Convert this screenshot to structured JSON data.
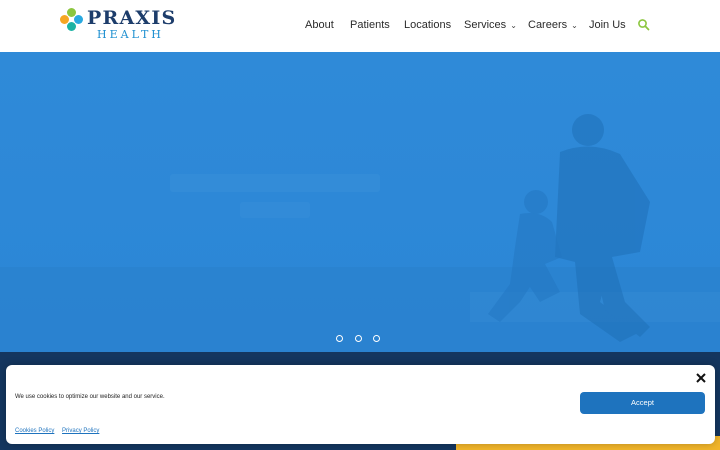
{
  "header": {
    "logo": {
      "name": "PRAXIS",
      "sub": "HEALTH"
    },
    "nav": [
      {
        "label": "About"
      },
      {
        "label": "Patients"
      },
      {
        "label": "Locations"
      },
      {
        "label": "Services",
        "has_dropdown": true
      },
      {
        "label": "Careers",
        "has_dropdown": true
      },
      {
        "label": "Join Us"
      }
    ],
    "search_icon": "search-icon",
    "search_color": "#8cc63f"
  },
  "hero": {
    "slide_count": 3,
    "overlay_color": "#2d89d7"
  },
  "cookie_banner": {
    "message": "We use cookies to optimize our website and our service.",
    "accept_label": "Accept",
    "links": [
      "Cookies Policy",
      "Privacy Policy"
    ],
    "close_icon": "close-icon"
  },
  "colors": {
    "brand_navy": "#1d3d6b",
    "brand_blue": "#1e73be",
    "band_navy": "#14365f",
    "accent_yellow": "#f1b52a"
  }
}
